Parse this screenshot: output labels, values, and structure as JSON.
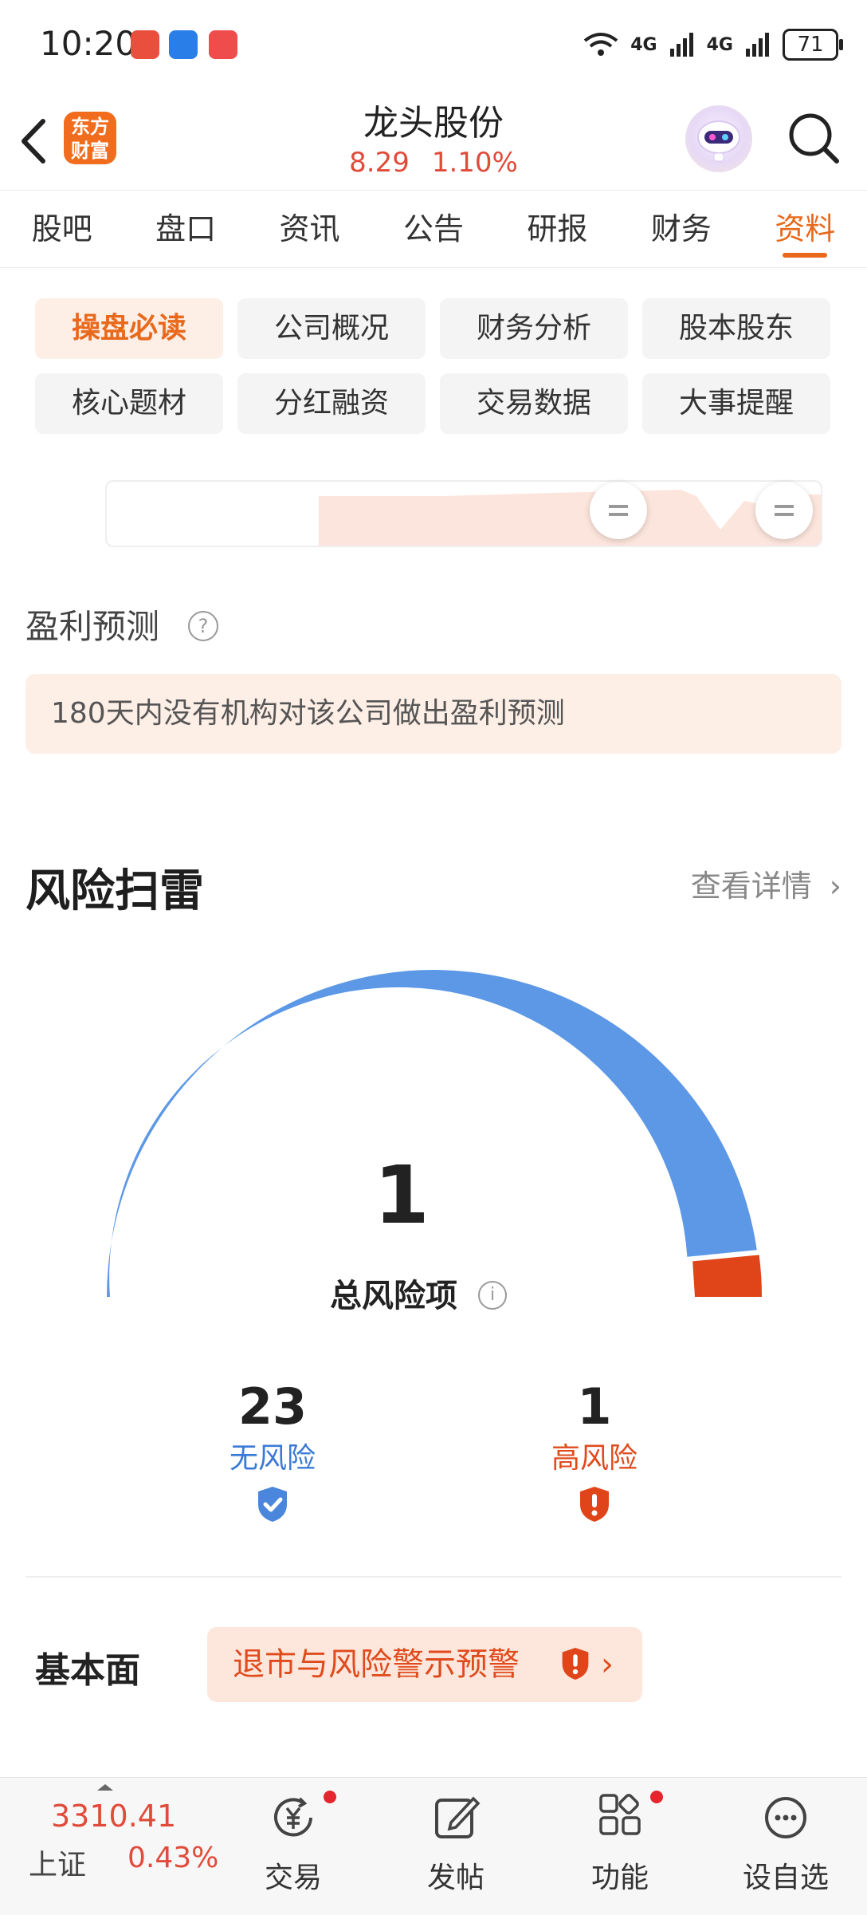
{
  "status_bar": {
    "time": "10:20",
    "network_1": "4G",
    "network_2": "4G",
    "battery": "71"
  },
  "header": {
    "logo_text": "东方财富",
    "stock_name": "龙头股份",
    "price": "8.29",
    "change_pct": "1.10%"
  },
  "tabs": [
    {
      "label": "股吧"
    },
    {
      "label": "盘口"
    },
    {
      "label": "资讯"
    },
    {
      "label": "公告"
    },
    {
      "label": "研报"
    },
    {
      "label": "财务"
    },
    {
      "label": "资料",
      "active": true
    }
  ],
  "sub_categories": [
    {
      "label": "操盘必读",
      "active": true
    },
    {
      "label": "公司概况"
    },
    {
      "label": "财务分析"
    },
    {
      "label": "股本股东"
    },
    {
      "label": "核心题材"
    },
    {
      "label": "分红融资"
    },
    {
      "label": "交易数据"
    },
    {
      "label": "大事提醒"
    }
  ],
  "profit_forecast": {
    "title": "盈利预测",
    "message": "180天内没有机构对该公司做出盈利预测"
  },
  "risk_scan": {
    "title": "风险扫雷",
    "detail_link": "查看详情",
    "total": "1",
    "total_label": "总风险项",
    "no_risk_count": "23",
    "no_risk_label": "无风险",
    "high_risk_count": "1",
    "high_risk_label": "高风险",
    "gauge_high_risk_fraction": 0.042,
    "colors": {
      "no_risk": "#5c98e6",
      "high_risk": "#e0451a"
    }
  },
  "fundamentals": {
    "label": "基本面",
    "alert": "退市与风险警示预警"
  },
  "bottom_nav": {
    "index_value": "3310.41",
    "index_name": "上证",
    "index_change": "0.43%",
    "items": [
      {
        "label": "交易",
        "icon": "yuan-cycle-icon"
      },
      {
        "label": "发帖",
        "icon": "compose-icon"
      },
      {
        "label": "功能",
        "icon": "grid-icon"
      },
      {
        "label": "设自选",
        "icon": "more-icon"
      }
    ]
  }
}
